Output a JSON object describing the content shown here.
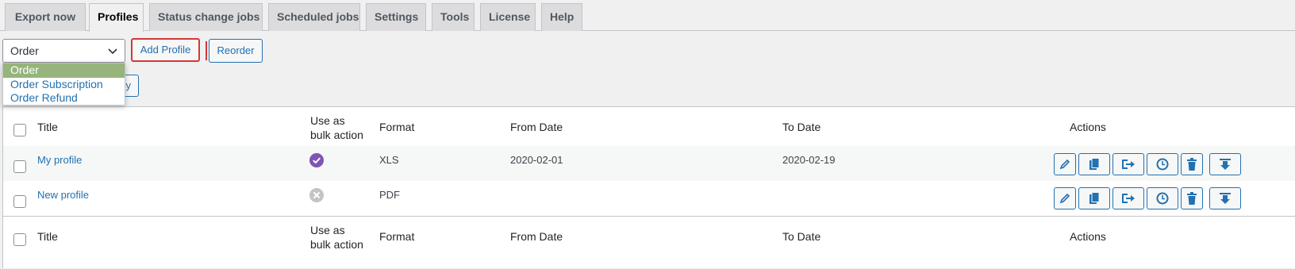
{
  "tabs": [
    {
      "label": "Export now",
      "active": false
    },
    {
      "label": "Profiles",
      "active": true
    },
    {
      "label": "Status change jobs",
      "active": false
    },
    {
      "label": "Scheduled jobs",
      "active": false
    },
    {
      "label": "Settings",
      "active": false
    },
    {
      "label": "Tools",
      "active": false
    },
    {
      "label": "License",
      "active": false
    },
    {
      "label": "Help",
      "active": false
    }
  ],
  "type_select": {
    "value": "Order",
    "options": [
      "Order",
      "Order Subscription",
      "Order Refund"
    ]
  },
  "buttons": {
    "add_profile": "Add Profile",
    "reorder": "Reorder",
    "apply_partial": "ly"
  },
  "table": {
    "columns": {
      "title": "Title",
      "bulk": "Use as bulk action",
      "bulk_line1": "Use as",
      "bulk_line2": "bulk action",
      "format": "Format",
      "from_date": "From Date",
      "to_date": "To Date",
      "actions": "Actions"
    },
    "rows": [
      {
        "title": "My profile",
        "bulk_action": true,
        "format": "XLS",
        "from_date": "2020-02-01",
        "to_date": "2020-02-19"
      },
      {
        "title": "New profile",
        "bulk_action": false,
        "format": "PDF",
        "from_date": "",
        "to_date": ""
      }
    ],
    "action_icons": [
      "pencil-icon",
      "copy-icon",
      "export-icon",
      "clock-icon",
      "trash-icon",
      "download-icon"
    ]
  },
  "colors": {
    "accent": "#2271b1",
    "highlight": "#d63638",
    "selected_option": "#96b47c",
    "enabled": "#7f54b3",
    "disabled": "#c3c4c7"
  }
}
